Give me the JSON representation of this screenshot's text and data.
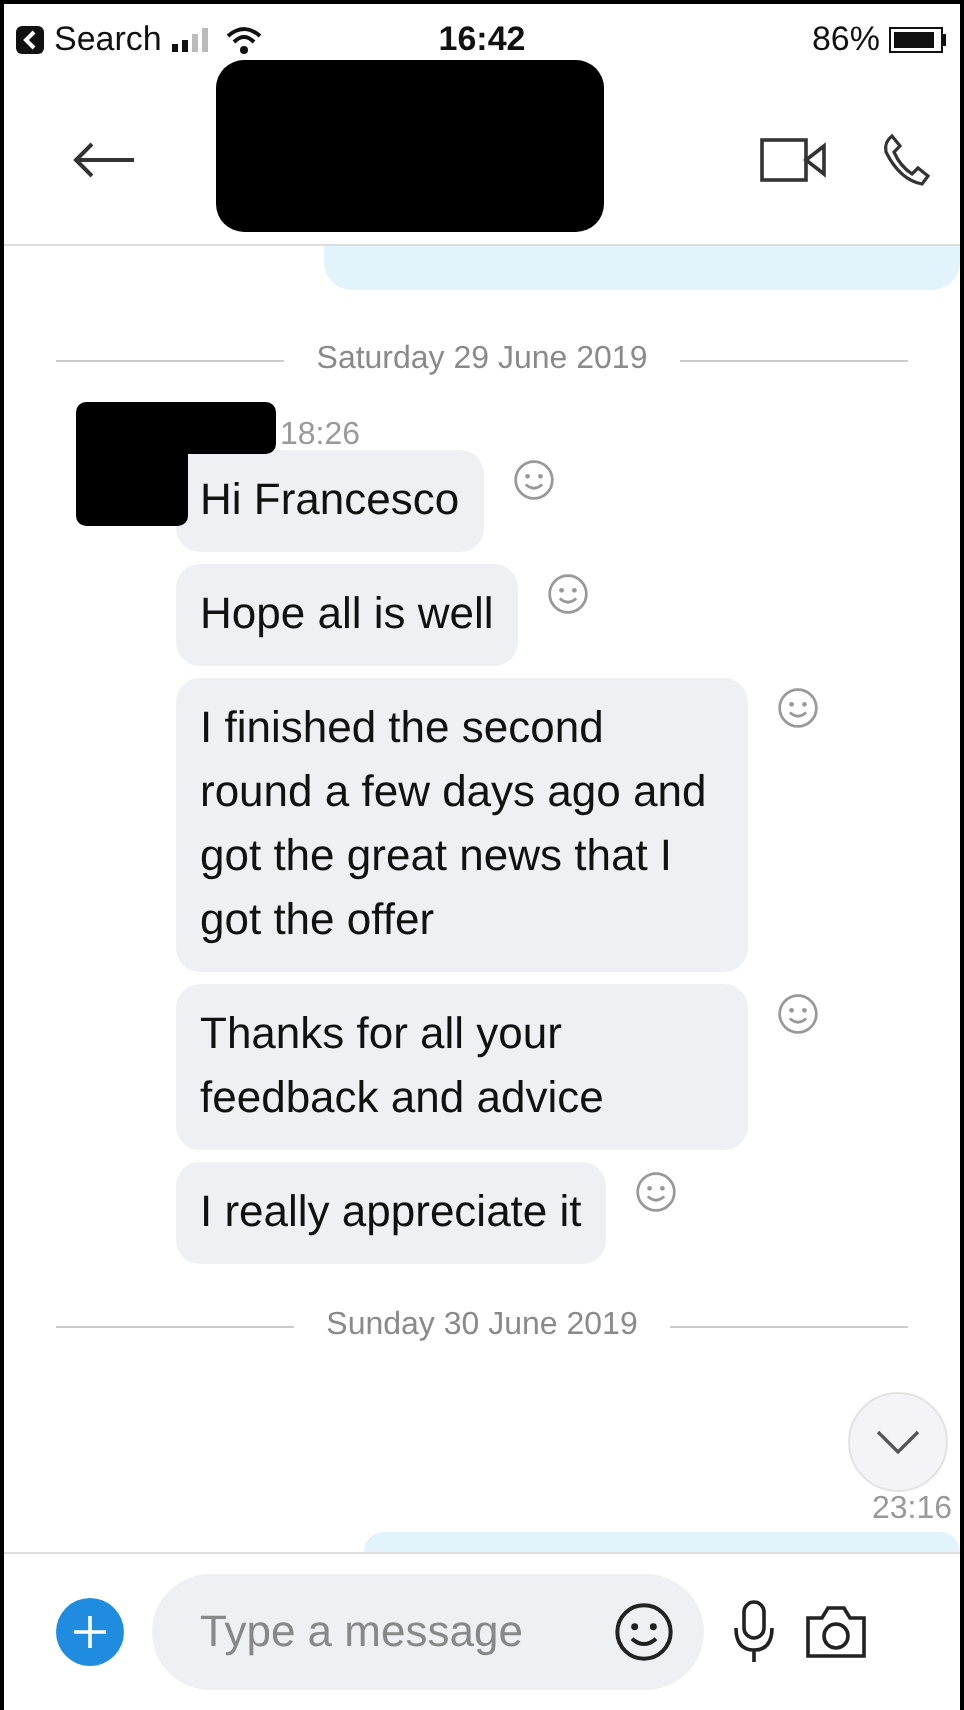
{
  "status_bar": {
    "back_label": "Search",
    "time": "16:42",
    "battery": "86%"
  },
  "header": {
    "redacted": true
  },
  "messages_top_partial": true,
  "date_1": "Saturday 29 June 2019",
  "sender": {
    "redacted": true,
    "time": "18:26"
  },
  "messages": [
    {
      "text": "Hi Francesco"
    },
    {
      "text": "Hope all is well"
    },
    {
      "text": "I finished the second round a few days ago and got the great news that I got the offer"
    },
    {
      "text": "Thanks for all your feedback and advice"
    },
    {
      "text": "I really appreciate it"
    }
  ],
  "date_2": "Sunday 30 June 2019",
  "last_time": "23:16",
  "composer": {
    "placeholder": "Type a message"
  }
}
